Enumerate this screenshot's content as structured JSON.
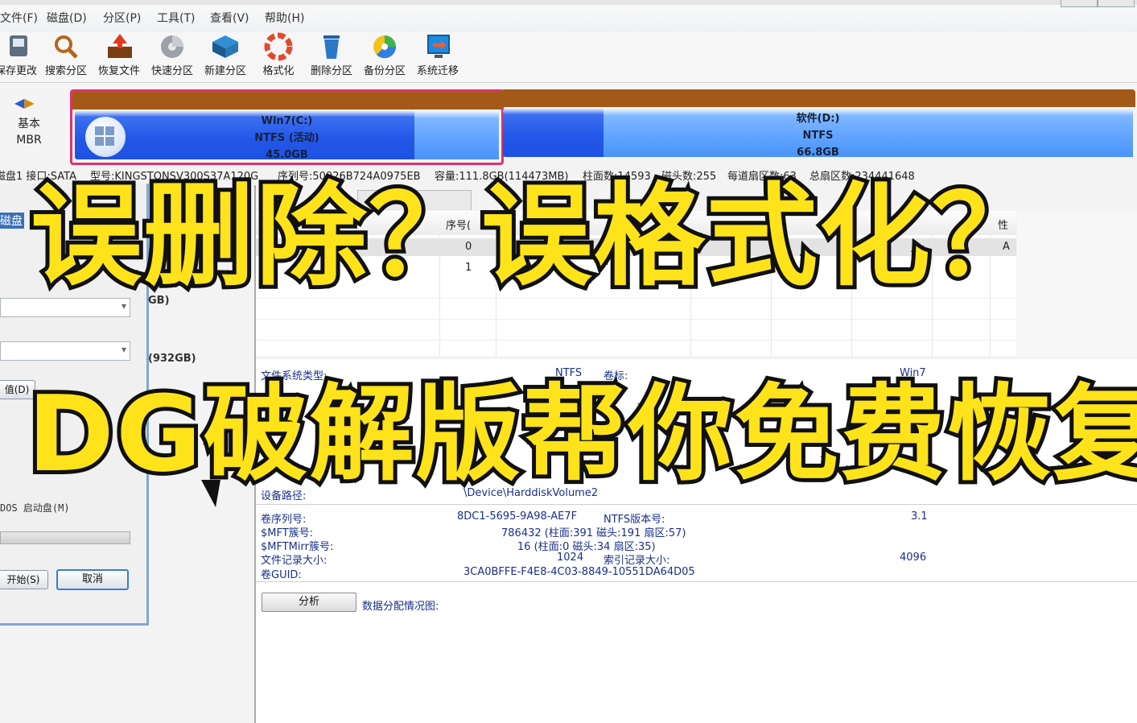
{
  "menubar": {
    "items": [
      "文件(F)",
      "磁盘(D)",
      "分区(P)",
      "工具(T)",
      "查看(V)",
      "帮助(H)"
    ]
  },
  "toolbar": {
    "buttons": [
      {
        "label": "保存更改",
        "icon": "save-icon"
      },
      {
        "label": "搜索分区",
        "icon": "search-icon"
      },
      {
        "label": "恢复文件",
        "icon": "recover-icon"
      },
      {
        "label": "快速分区",
        "icon": "quick-partition-icon"
      },
      {
        "label": "新建分区",
        "icon": "new-partition-icon"
      },
      {
        "label": "格式化",
        "icon": "format-icon"
      },
      {
        "label": "删除分区",
        "icon": "delete-icon"
      },
      {
        "label": "备份分区",
        "icon": "backup-icon"
      },
      {
        "label": "系统迁移",
        "icon": "migrate-icon"
      }
    ]
  },
  "diskmap": {
    "disk_type": "基本",
    "disk_scheme": "MBR",
    "partitions": [
      {
        "name": "Win7(C:)",
        "fs": "NTFS (活动)",
        "size": "45.0GB"
      },
      {
        "name": "软件(D:)",
        "fs": "NTFS",
        "size": "66.8GB"
      }
    ]
  },
  "disk_info": {
    "disk": "磁盘1 接口:SATA",
    "model": "型号:KINGSTONSV300S37A120G",
    "serial": "序列号:50026B724A0975EB",
    "capacity": "容量:111.8GB(114473MB)",
    "cylinders": "柱面数:14593",
    "heads": "磁头数:255",
    "sectors_per_track": "每道扇区数:63",
    "total_sectors": "总扇区数:234441648"
  },
  "left_panel": {
    "disk_label": "磁盘",
    "size_small": "GB)",
    "size_large": "(932GB)",
    "value_btn": "值(D)",
    "dos_text": "DOS 启动盘(M)",
    "start_btn": "开始(S)",
    "cancel_btn": "取消"
  },
  "grid": {
    "headers": {
      "seq": "序号(",
      "attr": "性"
    },
    "rows": [
      {
        "seq": "0",
        "attr": "A"
      },
      {
        "seq": "1",
        "attr": ""
      }
    ]
  },
  "details": {
    "fs_type_label": "文件系统类型:",
    "fs_type_value": "NTFS",
    "volume_label_label": "卷标:",
    "volume_label_value": "Win7",
    "device_path_label": "设备路径:",
    "device_path_value": "\\Device\\HarddiskVolume2",
    "serial_label": "卷序列号:",
    "serial_value": "8DC1-5695-9A98-AE7F",
    "ntfs_ver_label": "NTFS版本号:",
    "ntfs_ver_value": "3.1",
    "mft_label": "$MFT簇号:",
    "mft_value": "786432 (柱面:391 磁头:191 扇区:57)",
    "mftmirr_label": "$MFTMirr簇号:",
    "mftmirr_value": "16 (柱面:0 磁头:34 扇区:35)",
    "record_size_label": "文件记录大小:",
    "record_size_value": "1024",
    "index_size_label": "索引记录大小:",
    "index_size_value": "4096",
    "guid_label": "卷GUID:",
    "guid_value": "3CA0BFFE-F4E8-4C03-8849-10551DA64D05",
    "analyze_btn": "分析",
    "alloc_label": "数据分配情况图:"
  },
  "overlay": {
    "line1": "误删除？误格式化？",
    "line2": "DG破解版帮你免费恢复"
  },
  "colors": {
    "headline_fill": "#ffe31a",
    "headline_stroke": "#111111",
    "partition_blue": "#2356e8",
    "partition_header": "#a35a18",
    "selected_border": "#e03070"
  }
}
